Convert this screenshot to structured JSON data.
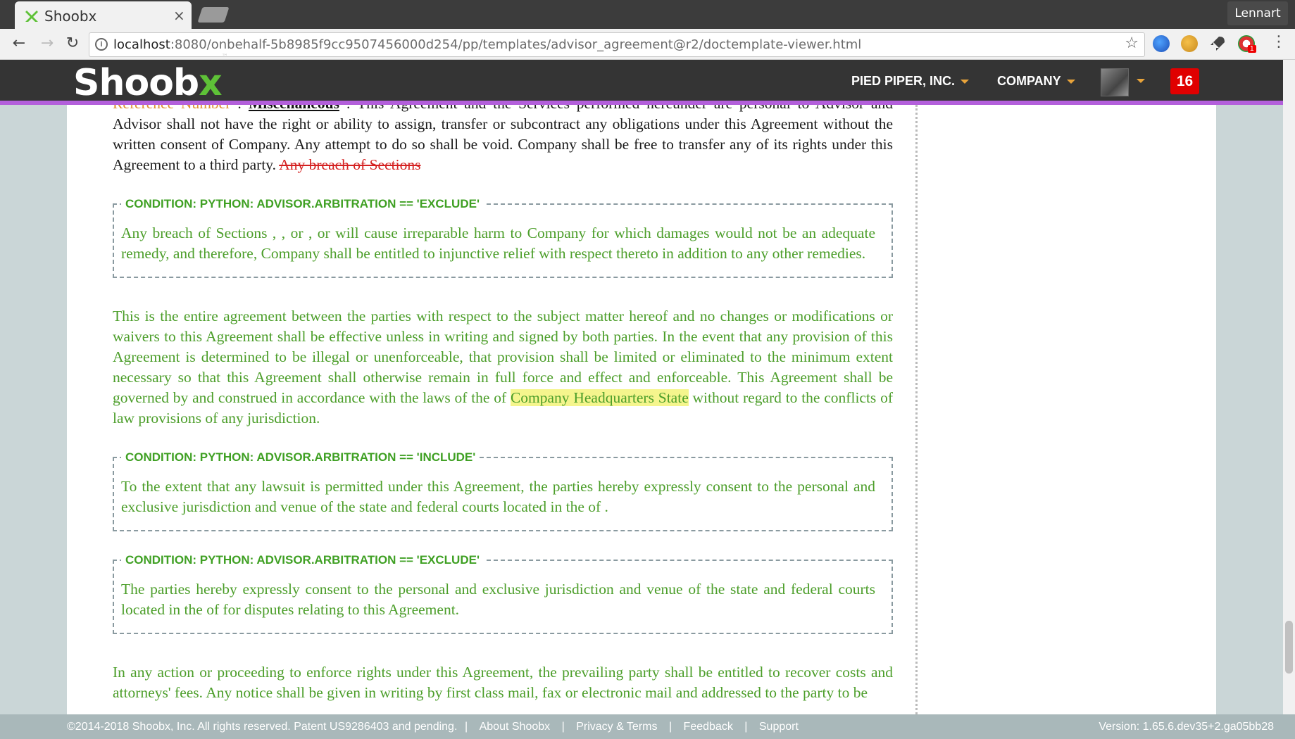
{
  "browser": {
    "tab_title": "Shoobx",
    "tab_close": "×",
    "profile_name": "Lennart",
    "url_host": "localhost",
    "url_rest": ":8080/onbehalf-5b8985f9cc9507456000d254/pp/templates/advisor_agreement@r2/doctemplate-viewer.html",
    "back": "←",
    "forward": "→",
    "reload": "↻",
    "bookmark_star": "☆",
    "menu": "⋮",
    "extension_badge": "1"
  },
  "header": {
    "logo_text": "Shoob",
    "logo_x": "x",
    "logo_tm": "™",
    "company_menu": "PIED PIPER, INC.",
    "section_menu": "COMPANY",
    "notification_count": "16"
  },
  "document": {
    "p1_orange": "Reference Number",
    "p1_colon": " : ",
    "p1_bold": "Miscellaneous",
    "p1_text": " : This Agreement and the Services performed hereunder are personal to Advisor and Advisor shall not have the right or ability to assign, transfer or subcontract any obligations under this Agreement without the written consent of Company. Any attempt to do so shall be void. Company shall be free to transfer any of its rights under this Agreement to a third party. ",
    "p1_strike": "Any breach of Sections",
    "cond1_label": "CONDITION: PYTHON: ADVISOR.ARBITRATION == 'EXCLUDE'",
    "cond1_text": "Any breach of Sections , , or , or will cause irreparable harm to Company for which damages would not be an adequate remedy, and therefore, Company shall be entitled to injunctive relief with respect thereto in addition to any other remedies.",
    "p2_text_a": "This is the entire agreement between the parties with respect to the subject matter hereof and no changes or modifications or waivers to this Agreement shall be effective unless in writing and signed by both parties. In the event that any provision of this Agreement is determined to be illegal or unenforceable, that provision shall be limited or eliminated to the minimum extent necessary so that this Agreement shall otherwise remain in full force and effect and enforceable. This Agreement shall be governed by and construed in accordance with the laws of the of ",
    "p2_highlight": "Company Headquarters State",
    "p2_text_b": " without regard to the conflicts of law provisions of any jurisdiction.",
    "cond2_label": "CONDITION: PYTHON: ADVISOR.ARBITRATION == 'INCLUDE'",
    "cond2_text": "To the extent that any lawsuit is permitted under this Agreement, the parties hereby expressly consent to the personal and exclusive jurisdiction and venue of the state and federal courts located in the of .",
    "cond3_label": "CONDITION: PYTHON: ADVISOR.ARBITRATION == 'EXCLUDE'",
    "cond3_text": "The parties hereby expressly consent to the personal and exclusive jurisdiction and venue of the state and federal courts located in the of for disputes relating to this Agreement.",
    "p3_text": "In any action or proceeding to enforce rights under this Agreement, the prevailing party shall be entitled to recover costs and attorneys' fees. Any notice shall be given in writing by first class mail, fax or electronic mail and addressed to the party to be"
  },
  "footer": {
    "copyright": "©2014-2018 Shoobx, Inc. All rights reserved. Patent US9286403 and pending.",
    "separator": "|",
    "about": "About Shoobx",
    "privacy": "Privacy & Terms",
    "feedback": "Feedback",
    "support": "Support",
    "version": "Version: 1.65.6.dev35+2.ga05bb28"
  },
  "colors": {
    "accent_purple": "#b35fdb",
    "logo_green": "#5ec137",
    "condition_green": "#3fa023",
    "text_green": "#4c9e2a",
    "notification_red": "#e00000"
  },
  "icons": [
    "shoobx-favicon",
    "info-icon",
    "star-icon",
    "globe-extension-icon",
    "cookie-extension-icon",
    "rocket-extension-icon",
    "chrome-extension-icon",
    "kebab-menu-icon"
  ]
}
